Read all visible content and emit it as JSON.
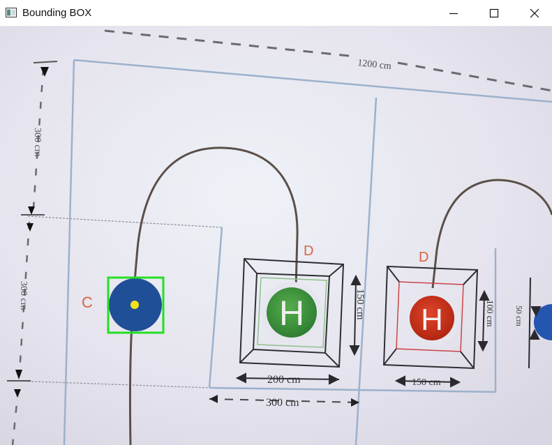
{
  "window": {
    "title": "Bounding BOX",
    "controls": [
      "minimize",
      "maximize",
      "close"
    ]
  },
  "camera_view": {
    "top_dimension": "1200 cm",
    "left_dimension_top": "300 cm",
    "left_dimension_mid": "300 cm",
    "label_c": "C",
    "label_d1": "D",
    "label_d2": "D",
    "pad1_letter": "H",
    "pad2_letter": "H",
    "pad1_width": "200 cm",
    "pad1_height": "150 cm",
    "pad2_width": "150 cm",
    "pad2_height": "100 cm",
    "bottom_dimension": "300 cm",
    "right_edge_dim": "50 cm",
    "colors": {
      "bbox": "#22e022",
      "center_dot": "#f2e21a",
      "target_disk": "#1f4f96",
      "pad_green": "#3f9a3a",
      "pad_red": "#c9321e",
      "label_red": "#d9623f"
    }
  }
}
